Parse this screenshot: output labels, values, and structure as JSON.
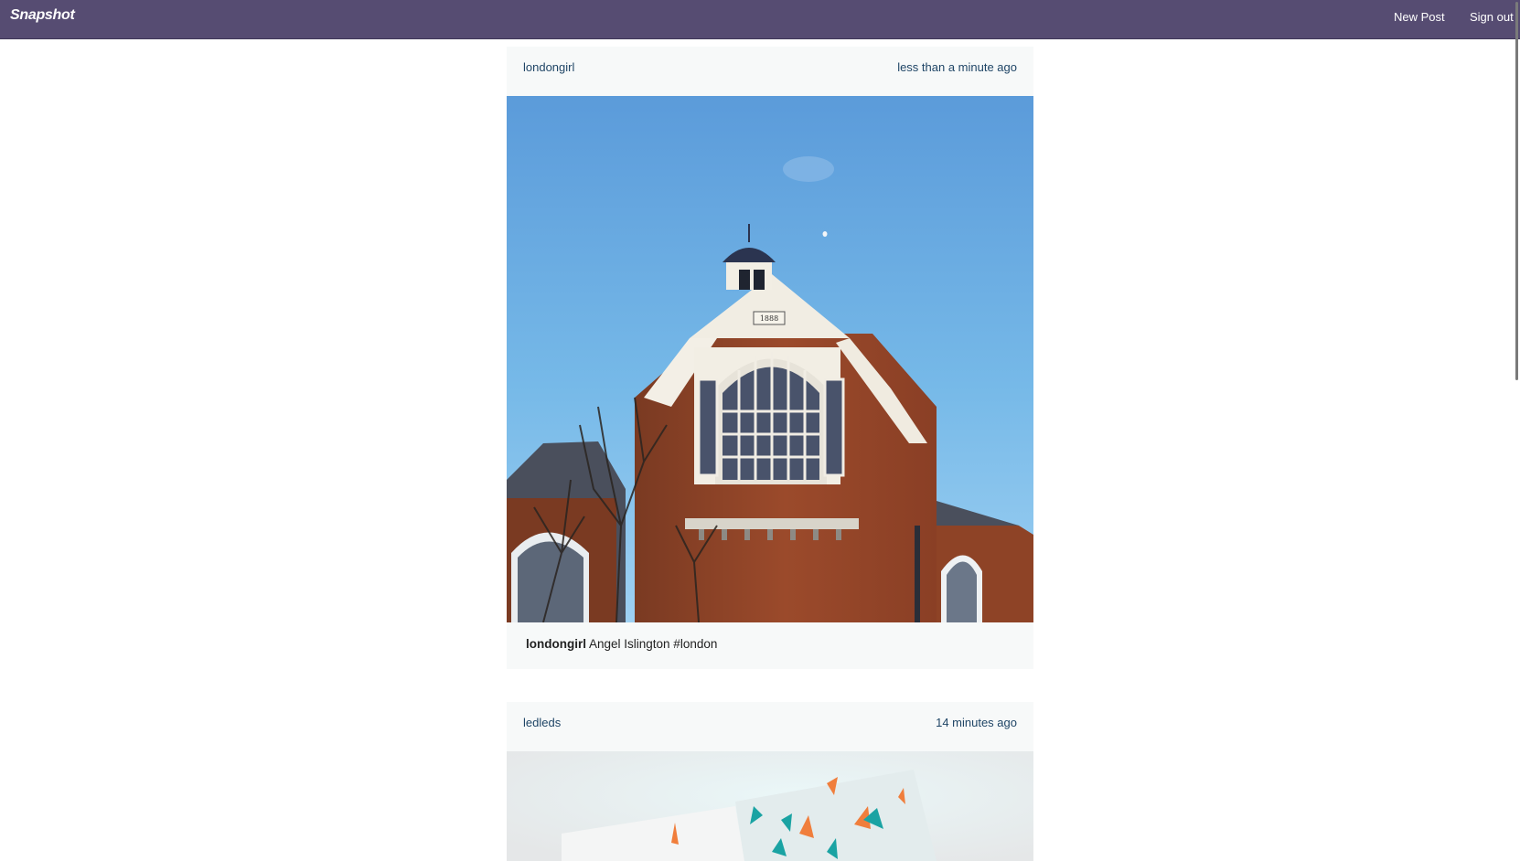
{
  "navbar": {
    "brand": "Snapshot",
    "new_post": "New Post",
    "sign_out": "Sign out"
  },
  "colors": {
    "navbar": "#564c72",
    "post_bg": "#f7f9f9",
    "link": "#1f4566"
  },
  "posts": [
    {
      "username": "londongirl",
      "time": "less than a minute ago",
      "image": "building-photo",
      "caption_user": "londongirl",
      "caption_text": "Angel Islington #london"
    },
    {
      "username": "ledleds",
      "time": "14 minutes ago",
      "image": "papers-photo"
    }
  ]
}
